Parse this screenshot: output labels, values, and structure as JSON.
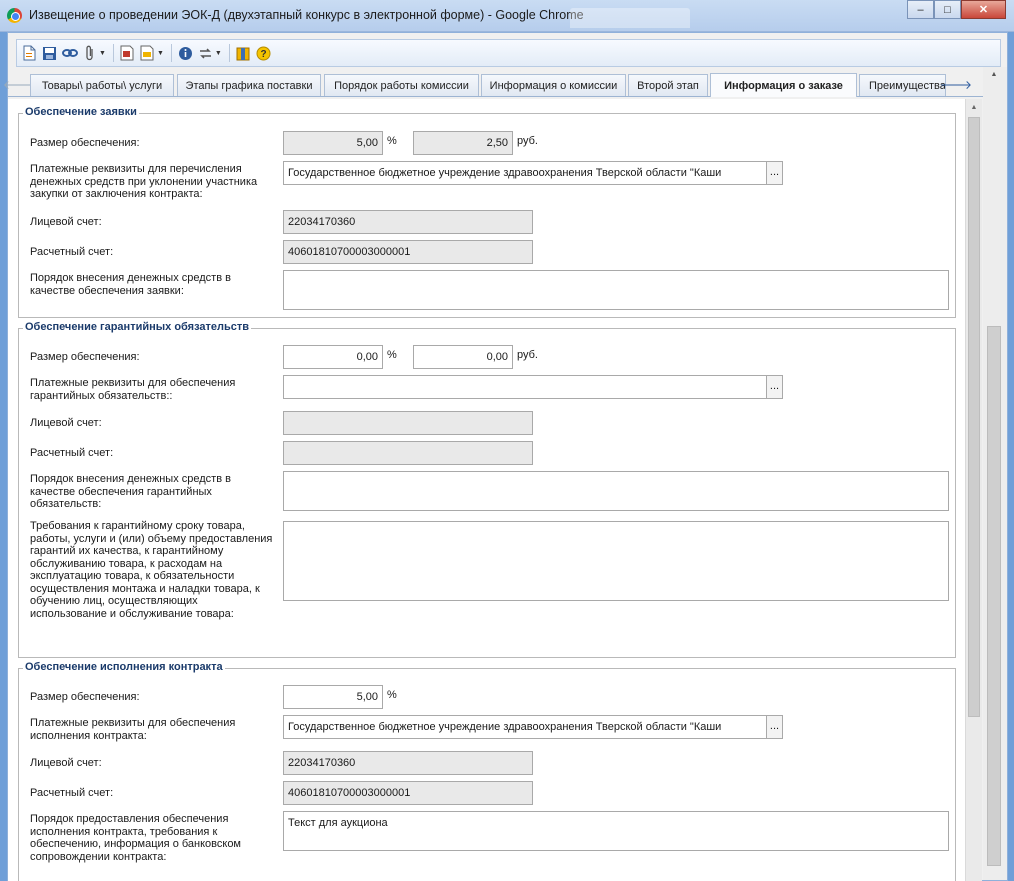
{
  "window": {
    "title": "Извещение о проведении ЭОК-Д (двухэтапный конкурс в электронной форме) - Google Chrome",
    "minimize": "‒",
    "maximize": "□",
    "close": "✕"
  },
  "toolbar": {
    "icons": [
      "new-doc-icon",
      "save-icon",
      "link-icon",
      "paperclip-icon",
      "report-icon",
      "export-icon",
      "info-icon",
      "refresh-icon",
      "archive-icon",
      "help-icon"
    ]
  },
  "tabs": {
    "left_arrow": "🡐",
    "right_arrow": "🡒",
    "items": [
      {
        "label": "Товары\\ работы\\ услуги"
      },
      {
        "label": "Этапы графика поставки"
      },
      {
        "label": "Порядок работы комиссии"
      },
      {
        "label": "Информация о комиссии"
      },
      {
        "label": "Второй этап"
      },
      {
        "label": "Информация о заказе"
      },
      {
        "label": "Преимущества"
      }
    ]
  },
  "section1": {
    "title": "Обеспечение заявки",
    "size_label": "Размер обеспечения:",
    "percent_value": "5,00",
    "percent_unit": "%",
    "rub_value": "2,50",
    "rub_unit": "руб.",
    "requisites_label": "Платежные реквизиты для перечисления денежных средств при уклонении участника закупки от заключения контракта:",
    "requisites_value": "Государственное бюджетное учреждение здравоохранения Тверской области \"Каши",
    "account_label": "Лицевой счет:",
    "account_value": "22034170360",
    "settlement_label": "Расчетный счет:",
    "settlement_value": "40601810700003000001",
    "order_label": "Порядок внесения денежных средств в качестве обеспечения заявки:",
    "order_value": ""
  },
  "section2": {
    "title": "Обеспечение гарантийных обязательств",
    "size_label": "Размер обеспечения:",
    "percent_value": "0,00",
    "percent_unit": "%",
    "rub_value": "0,00",
    "rub_unit": "руб.",
    "requisites_label": "Платежные реквизиты для обеспечения гарантийных обязательств::",
    "requisites_value": "",
    "account_label": "Лицевой счет:",
    "account_value": "",
    "settlement_label": "Расчетный счет:",
    "settlement_value": "",
    "order_label": "Порядок внесения денежных средств в качестве обеспечения гарантийных обязательств:",
    "order_value": "",
    "warranty_label": "Требования к гарантийному сроку товара, работы, услуги и (или) объему предоставления гарантий их качества, к гарантийному обслуживанию товара, к расходам на эксплуатацию товара, к обязательности осуществления монтажа и наладки товара, к обучению лиц, осуществляющих использование и обслуживание товара:",
    "warranty_value": ""
  },
  "section3": {
    "title": "Обеспечение исполнения контракта",
    "size_label": "Размер обеспечения:",
    "percent_value": "5,00",
    "percent_unit": "%",
    "requisites_label": "Платежные реквизиты для обеспечения исполнения контракта:",
    "requisites_value": "Государственное бюджетное учреждение здравоохранения Тверской области \"Каши",
    "account_label": "Лицевой счет:",
    "account_value": "22034170360",
    "settlement_label": "Расчетный счет:",
    "settlement_value": "40601810700003000001",
    "order_label": "Порядок предоставления обеспечения исполнения контракта, требования к обеспечению, информация о банковском сопровождении контракта:",
    "order_value": "Текст для аукциона"
  },
  "dots_label": "..."
}
